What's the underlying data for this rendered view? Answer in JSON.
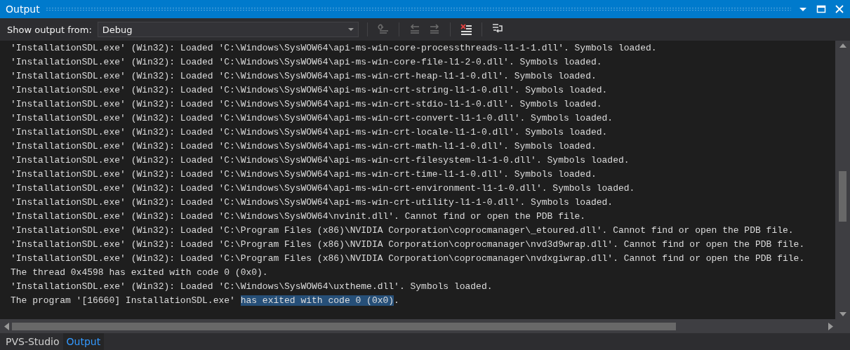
{
  "window": {
    "title": "Output"
  },
  "toolbar": {
    "label": "Show output from:",
    "source": {
      "value": "Debug"
    }
  },
  "lines": [
    {
      "segments": [
        {
          "text": "'InstallationSDL.exe' (Win32): Loaded 'C:\\Windows\\SysWOW64\\api-ms-win-core-processthreads-l1-1-1.dll'. Symbols loaded.",
          "selected": false
        }
      ]
    },
    {
      "segments": [
        {
          "text": "'InstallationSDL.exe' (Win32): Loaded 'C:\\Windows\\SysWOW64\\api-ms-win-core-file-l1-2-0.dll'. Symbols loaded.",
          "selected": false
        }
      ]
    },
    {
      "segments": [
        {
          "text": "'InstallationSDL.exe' (Win32): Loaded 'C:\\Windows\\SysWOW64\\api-ms-win-crt-heap-l1-1-0.dll'. Symbols loaded.",
          "selected": false
        }
      ]
    },
    {
      "segments": [
        {
          "text": "'InstallationSDL.exe' (Win32): Loaded 'C:\\Windows\\SysWOW64\\api-ms-win-crt-string-l1-1-0.dll'. Symbols loaded.",
          "selected": false
        }
      ]
    },
    {
      "segments": [
        {
          "text": "'InstallationSDL.exe' (Win32): Loaded 'C:\\Windows\\SysWOW64\\api-ms-win-crt-stdio-l1-1-0.dll'. Symbols loaded.",
          "selected": false
        }
      ]
    },
    {
      "segments": [
        {
          "text": "'InstallationSDL.exe' (Win32): Loaded 'C:\\Windows\\SysWOW64\\api-ms-win-crt-convert-l1-1-0.dll'. Symbols loaded.",
          "selected": false
        }
      ]
    },
    {
      "segments": [
        {
          "text": "'InstallationSDL.exe' (Win32): Loaded 'C:\\Windows\\SysWOW64\\api-ms-win-crt-locale-l1-1-0.dll'. Symbols loaded.",
          "selected": false
        }
      ]
    },
    {
      "segments": [
        {
          "text": "'InstallationSDL.exe' (Win32): Loaded 'C:\\Windows\\SysWOW64\\api-ms-win-crt-math-l1-1-0.dll'. Symbols loaded.",
          "selected": false
        }
      ]
    },
    {
      "segments": [
        {
          "text": "'InstallationSDL.exe' (Win32): Loaded 'C:\\Windows\\SysWOW64\\api-ms-win-crt-filesystem-l1-1-0.dll'. Symbols loaded.",
          "selected": false
        }
      ]
    },
    {
      "segments": [
        {
          "text": "'InstallationSDL.exe' (Win32): Loaded 'C:\\Windows\\SysWOW64\\api-ms-win-crt-time-l1-1-0.dll'. Symbols loaded.",
          "selected": false
        }
      ]
    },
    {
      "segments": [
        {
          "text": "'InstallationSDL.exe' (Win32): Loaded 'C:\\Windows\\SysWOW64\\api-ms-win-crt-environment-l1-1-0.dll'. Symbols loaded.",
          "selected": false
        }
      ]
    },
    {
      "segments": [
        {
          "text": "'InstallationSDL.exe' (Win32): Loaded 'C:\\Windows\\SysWOW64\\api-ms-win-crt-utility-l1-1-0.dll'. Symbols loaded.",
          "selected": false
        }
      ]
    },
    {
      "segments": [
        {
          "text": "'InstallationSDL.exe' (Win32): Loaded 'C:\\Windows\\SysWOW64\\nvinit.dll'. Cannot find or open the PDB file.",
          "selected": false
        }
      ]
    },
    {
      "segments": [
        {
          "text": "'InstallationSDL.exe' (Win32): Loaded 'C:\\Program Files (x86)\\NVIDIA Corporation\\coprocmanager\\_etoured.dll'. Cannot find or open the PDB file.",
          "selected": false
        }
      ]
    },
    {
      "segments": [
        {
          "text": "'InstallationSDL.exe' (Win32): Loaded 'C:\\Program Files (x86)\\NVIDIA Corporation\\coprocmanager\\nvd3d9wrap.dll'. Cannot find or open the PDB file.",
          "selected": false
        }
      ]
    },
    {
      "segments": [
        {
          "text": "'InstallationSDL.exe' (Win32): Loaded 'C:\\Program Files (x86)\\NVIDIA Corporation\\coprocmanager\\nvdxgiwrap.dll'. Cannot find or open the PDB file.",
          "selected": false
        }
      ]
    },
    {
      "segments": [
        {
          "text": "The thread 0x4598 has exited with code 0 (0x0).",
          "selected": false
        }
      ]
    },
    {
      "segments": [
        {
          "text": "'InstallationSDL.exe' (Win32): Loaded 'C:\\Windows\\SysWOW64\\uxtheme.dll'. Symbols loaded.",
          "selected": false
        }
      ]
    },
    {
      "segments": [
        {
          "text": "The program '[16660] InstallationSDL.exe' ",
          "selected": false
        },
        {
          "text": "has exited with code 0 (0x0)",
          "selected": true
        },
        {
          "text": ".",
          "selected": false
        }
      ]
    }
  ],
  "tabs": [
    {
      "label": "PVS-Studio",
      "selected": false
    },
    {
      "label": "Output",
      "selected": true
    }
  ]
}
